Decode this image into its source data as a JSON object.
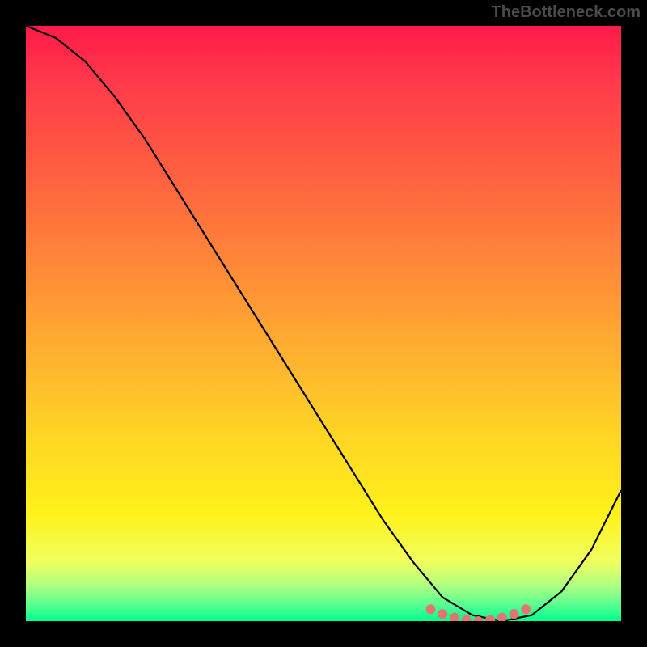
{
  "watermark": "TheBottleneck.com",
  "chart_data": {
    "type": "line",
    "title": "",
    "xlabel": "",
    "ylabel": "",
    "xlim": [
      0,
      100
    ],
    "ylim": [
      0,
      100
    ],
    "x": [
      0,
      5,
      10,
      15,
      20,
      25,
      30,
      35,
      40,
      45,
      50,
      55,
      60,
      65,
      70,
      75,
      80,
      85,
      90,
      95,
      100
    ],
    "values": [
      100,
      98,
      94,
      88,
      81,
      73,
      65,
      57,
      49,
      41,
      33,
      25,
      17,
      10,
      4,
      1,
      0,
      1,
      5,
      12,
      22
    ],
    "markers": {
      "x": [
        68,
        70,
        72,
        74,
        76,
        78,
        80,
        82,
        84
      ],
      "y": [
        2.0,
        1.2,
        0.6,
        0.2,
        0.0,
        0.2,
        0.6,
        1.2,
        2.0
      ],
      "color": "#e57373"
    },
    "gradient_stops": [
      {
        "pct": 0,
        "color": "#ff1a4a"
      },
      {
        "pct": 10,
        "color": "#ff3b4a"
      },
      {
        "pct": 25,
        "color": "#ff6040"
      },
      {
        "pct": 40,
        "color": "#ff8838"
      },
      {
        "pct": 55,
        "color": "#ffb030"
      },
      {
        "pct": 70,
        "color": "#ffd824"
      },
      {
        "pct": 82,
        "color": "#fff21a"
      },
      {
        "pct": 90,
        "color": "#f0ff60"
      },
      {
        "pct": 94,
        "color": "#b0ff80"
      },
      {
        "pct": 97,
        "color": "#60ff90"
      },
      {
        "pct": 100,
        "color": "#00ff90"
      }
    ]
  }
}
